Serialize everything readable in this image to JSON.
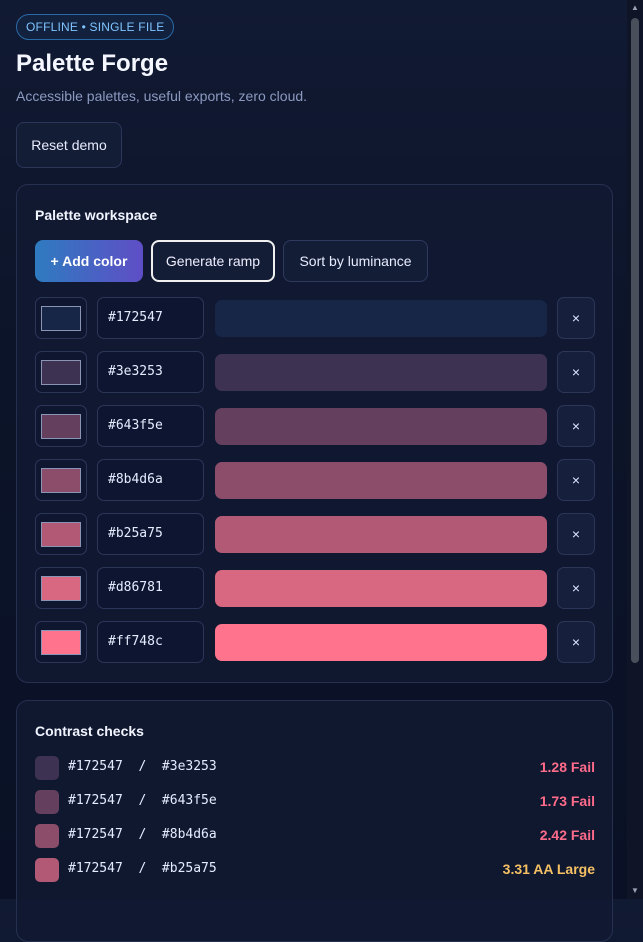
{
  "header": {
    "badge": "OFFLINE • SINGLE FILE",
    "title": "Palette Forge",
    "subtitle": "Accessible palettes, useful exports, zero cloud.",
    "reset_label": "Reset demo"
  },
  "workspace": {
    "title": "Palette workspace",
    "add_label": "+ Add color",
    "ramp_label": "Generate ramp",
    "sort_label": "Sort by luminance",
    "remove_glyph": "×",
    "colors": [
      {
        "hex": "#172547"
      },
      {
        "hex": "#3e3253"
      },
      {
        "hex": "#643f5e"
      },
      {
        "hex": "#8b4d6a"
      },
      {
        "hex": "#b25a75"
      },
      {
        "hex": "#d86781"
      },
      {
        "hex": "#ff748c"
      }
    ]
  },
  "contrast": {
    "title": "Contrast checks",
    "rows": [
      {
        "pair": "#172547  /  #3e3253",
        "swatch": "#3e3253",
        "result": "1.28 Fail",
        "color": "#ff6b8a"
      },
      {
        "pair": "#172547  /  #643f5e",
        "swatch": "#643f5e",
        "result": "1.73 Fail",
        "color": "#ff6b8a"
      },
      {
        "pair": "#172547  /  #8b4d6a",
        "swatch": "#8b4d6a",
        "result": "2.42 Fail",
        "color": "#ff6b8a"
      },
      {
        "pair": "#172547  /  #b25a75",
        "swatch": "#b25a75",
        "result": "3.31 AA Large",
        "color": "#f5c063"
      }
    ]
  }
}
